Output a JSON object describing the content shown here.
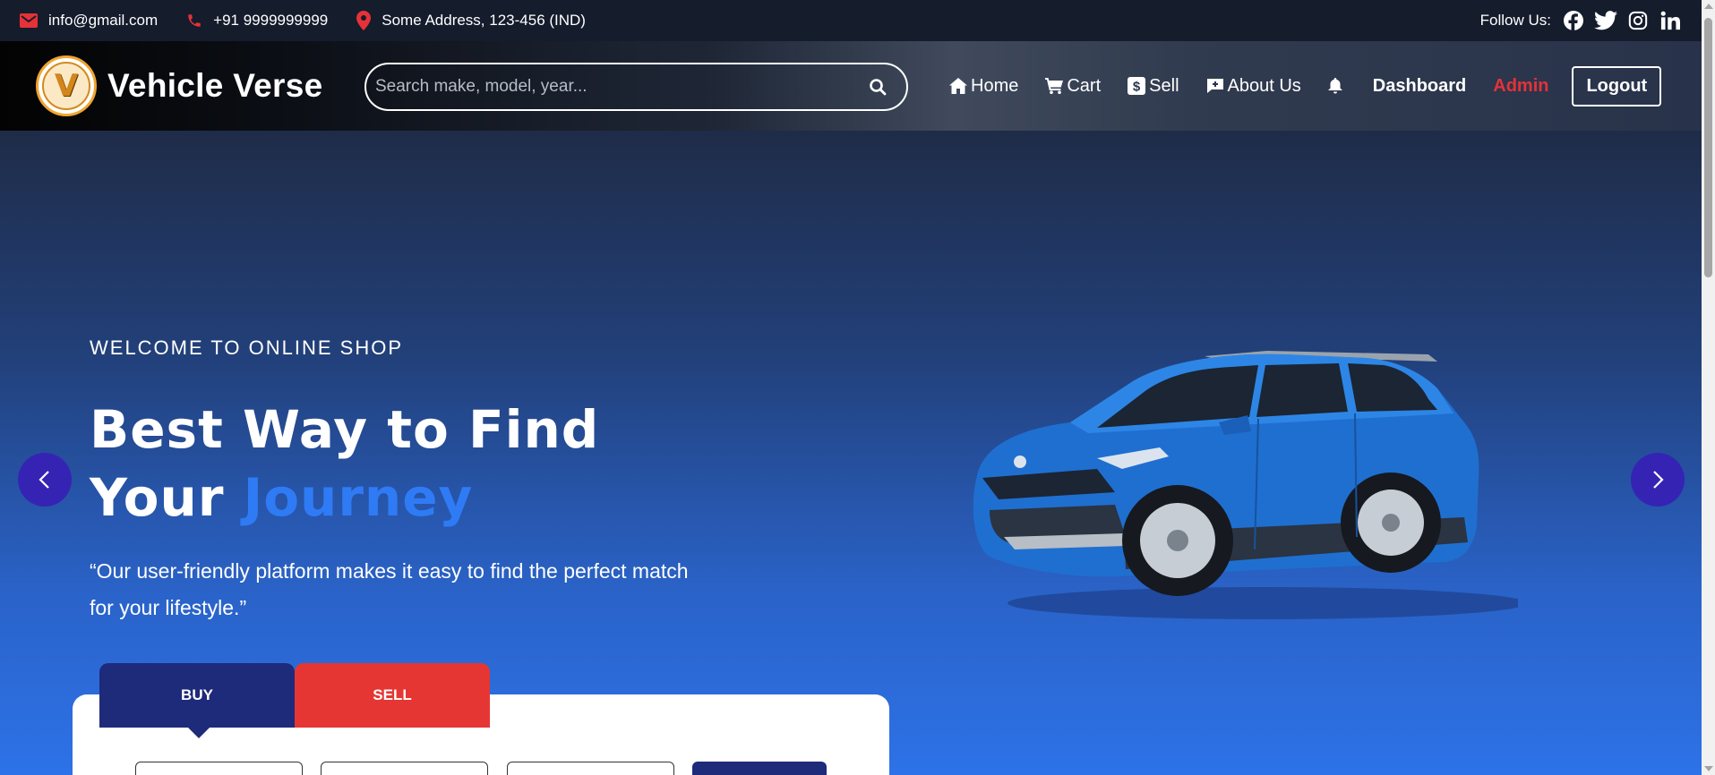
{
  "topbar": {
    "email": "info@gmail.com",
    "phone": "+91 9999999999",
    "address": "Some Address, 123-456 (IND)",
    "follow_label": "Follow Us:",
    "socials": [
      "facebook-icon",
      "twitter-icon",
      "instagram-icon",
      "linkedin-icon"
    ]
  },
  "brand": {
    "logo_letter": "V",
    "name": "Vehicle Verse"
  },
  "search": {
    "placeholder": "Search make, model, year...",
    "value": ""
  },
  "nav": {
    "home": "Home",
    "cart": "Cart",
    "sell": "Sell",
    "about": "About Us",
    "dashboard": "Dashboard",
    "admin": "Admin",
    "logout": "Logout"
  },
  "hero": {
    "welcome": "WELCOME TO ONLINE SHOP",
    "headline_line1": "Best Way to Find",
    "headline_line2_plain": "Your ",
    "headline_line2_accent": "Journey",
    "quote": "“Our user-friendly platform makes it easy to find the perfect match for your lifestyle.”"
  },
  "tabs": {
    "buy": "BUY",
    "sell": "SELL"
  },
  "colors": {
    "topbar_bg": "#151c2c",
    "accent_blue": "#2f7bf5",
    "admin_red": "#e53238",
    "buy_tab": "#1e2a7a",
    "sell_tab": "#e53634",
    "slider_arrow": "#3524b4",
    "icon_red": "#e53238"
  }
}
